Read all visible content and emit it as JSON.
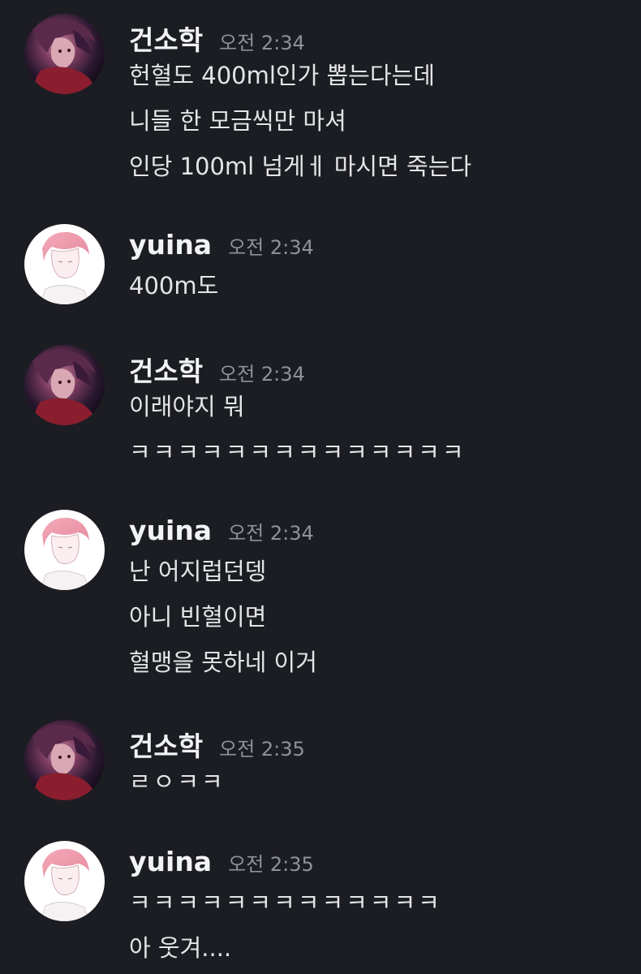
{
  "messages": [
    {
      "author": "건소학",
      "avatar": "dark-character-avatar",
      "time": "오전 2:34",
      "lines": [
        "헌혈도 400ml인가 뽑는다는데",
        "니들 한 모금씩만 마셔",
        "인당 100ml 넘게ㅔ 마시면 죽는다"
      ]
    },
    {
      "author": "yuina",
      "avatar": "pink-sketch-avatar",
      "time": "오전 2:34",
      "lines": [
        "400m도"
      ]
    },
    {
      "author": "건소학",
      "avatar": "dark-character-avatar",
      "time": "오전 2:34",
      "lines": [
        "이래야지 뭐",
        "ㅋㅋㅋㅋㅋㅋㅋㅋㅋㅋㅋㅋㅋㅋ"
      ]
    },
    {
      "author": "yuina",
      "avatar": "pink-sketch-avatar",
      "time": "오전 2:34",
      "lines": [
        "난 어지럽던뎅",
        "아니 빈혈이면",
        "혈맹을 못하네 이거"
      ]
    },
    {
      "author": "건소학",
      "avatar": "dark-character-avatar",
      "time": "오전 2:35",
      "lines": [
        "ㄹㅇㅋㅋ"
      ]
    },
    {
      "author": "yuina",
      "avatar": "pink-sketch-avatar",
      "time": "오전 2:35",
      "lines": [
        "ㅋㅋㅋㅋㅋㅋㅋㅋㅋㅋㅋㅋㅋ",
        "아 웃겨...."
      ]
    }
  ],
  "colors": {
    "background": "#1c1d22",
    "username": "#f2f3f5",
    "timestamp": "#8e9297",
    "message_text": "#e3e5e8"
  }
}
